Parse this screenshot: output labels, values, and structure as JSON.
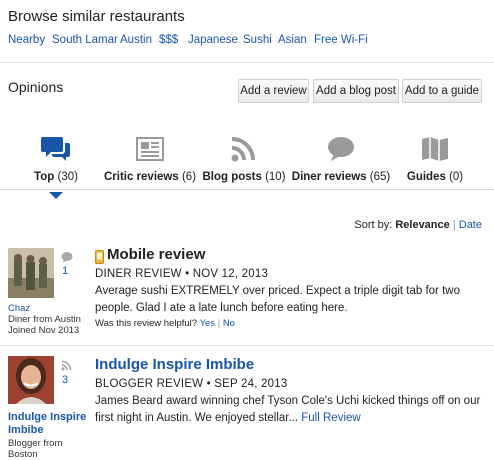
{
  "browse": {
    "title": "Browse similar restaurants",
    "tags": [
      "Nearby",
      "South Lamar",
      "Austin",
      "$$$",
      "Japanese",
      "Sushi",
      "Asian",
      "Free Wi-Fi"
    ]
  },
  "opinions": {
    "title": "Opinions",
    "buttons": {
      "add_review": "Add a review",
      "add_blog": "Add a blog post",
      "add_guide": "Add to a guide"
    }
  },
  "tabs": [
    {
      "label": "Top",
      "count": "(30)",
      "icon": "speech-bubbles-icon",
      "active": true
    },
    {
      "label": "Critic reviews",
      "count": "(6)",
      "icon": "newspaper-icon"
    },
    {
      "label": "Blog posts",
      "count": "(10)",
      "icon": "rss-icon"
    },
    {
      "label": "Diner reviews",
      "count": "(65)",
      "icon": "speech-bubble-icon"
    },
    {
      "label": "Guides",
      "count": "(0)",
      "icon": "map-icon"
    }
  ],
  "sort": {
    "label": "Sort by:",
    "active": "Relevance",
    "sep": "|",
    "other": "Date"
  },
  "reviews": [
    {
      "author": "Chaz",
      "author_line1": "Diner from Austin",
      "author_line2": "Joined Nov 2013",
      "count": "1",
      "title": "Mobile review",
      "meta": "DINER REVIEW • NOV 12, 2013",
      "text": "Average sushi EXTREMELY over priced. Expect a triple digit tab for two people. Glad I ate a late lunch before eating here.",
      "helpful": "Was this review helpful?",
      "yes": "Yes",
      "sep": "|",
      "no": "No"
    },
    {
      "author": "Indulge Inspire Imbibe",
      "author_line1": "Blogger from",
      "author_line2": "Boston",
      "count": "3",
      "title": "Indulge Inspire Imbibe",
      "meta": "BLOGGER REVIEW • SEP 24, 2013",
      "text": "James Beard award winning chef Tyson Cole's Uchi kicked things off on our first night in Austin. We enjoyed stellar...",
      "full_review": "Full Review"
    }
  ]
}
